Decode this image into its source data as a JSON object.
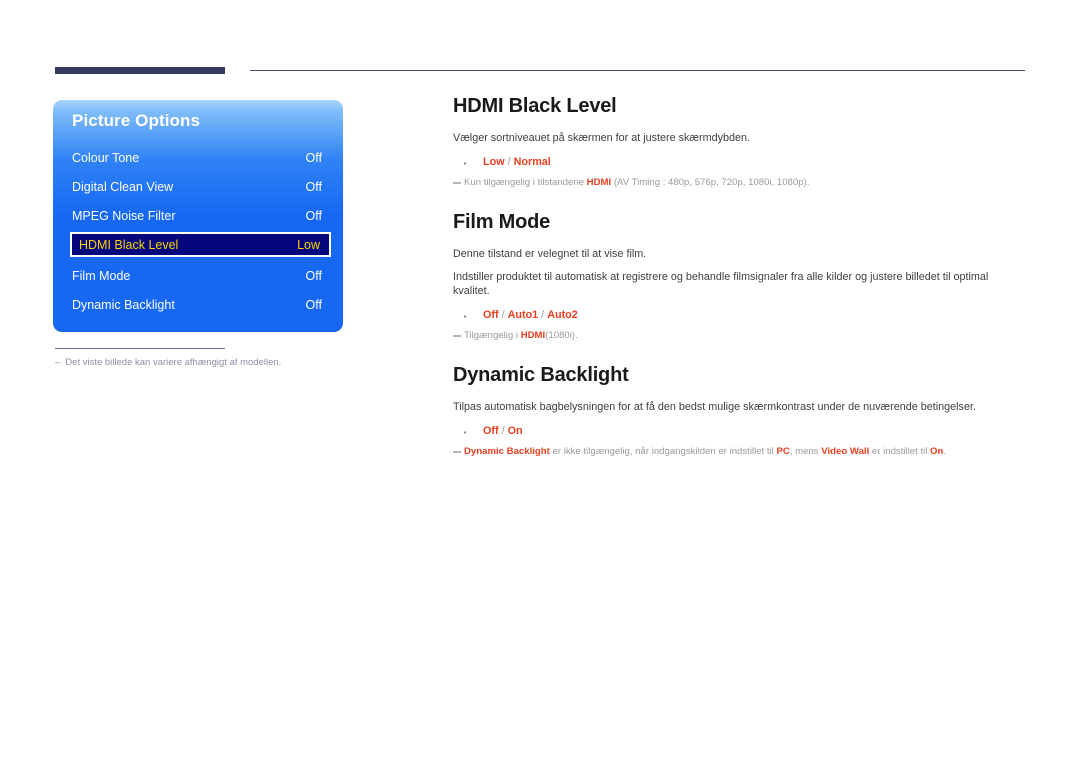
{
  "page": {
    "background": "#ffffff",
    "accent_color": "#E8401F",
    "rule_color": "#363B5E"
  },
  "osd": {
    "title": "Picture Options",
    "panel_top_color": "#a8d4fb",
    "panel_bottom_color": "#1668f2",
    "selected_bg": "#05057d",
    "selected_text_color": "#ffd400",
    "rows": [
      {
        "label": "Colour Tone",
        "value": "Off",
        "selected": false
      },
      {
        "label": "Digital Clean View",
        "value": "Off",
        "selected": false
      },
      {
        "label": "MPEG Noise Filter",
        "value": "Off",
        "selected": false
      },
      {
        "label": "HDMI Black Level",
        "value": "Low",
        "selected": true
      },
      {
        "label": "Film Mode",
        "value": "Off",
        "selected": false
      },
      {
        "label": "Dynamic Backlight",
        "value": "Off",
        "selected": false
      }
    ]
  },
  "footnote": {
    "dash": "–",
    "text": "Det viste billede kan variere afhængigt af modellen."
  },
  "sections": {
    "hdmi_black_level": {
      "heading": "HDMI Black Level",
      "paragraph": "Vælger sortniveauet på skærmen for at justere skærmdybden.",
      "option_main": "Low",
      "option_sep": " / ",
      "option_rest": "Normal",
      "note_pre": "Kun tilgængelig i tilstandene ",
      "note_hl": "HDMI",
      "note_post": " (AV Timing : 480p, 576p, 720p, 1080i, 1080p)."
    },
    "film_mode": {
      "heading": "Film Mode",
      "paragraph1": "Denne tilstand er velegnet til at vise film.",
      "paragraph2": "Indstiller produktet til automatisk at registrere og behandle filmsignaler fra alle kilder og justere billedet til optimal kvalitet.",
      "option_a": "Off",
      "option_sep1": " / ",
      "option_b": "Auto1",
      "option_sep2": " / ",
      "option_c": "Auto2",
      "note_pre": "Tilgængelig i ",
      "note_hl": "HDMI",
      "note_post": "(1080i)."
    },
    "dynamic_backlight": {
      "heading": "Dynamic Backlight",
      "paragraph": "Tilpas automatisk bagbelysningen for at få den bedst mulige skærmkontrast under de nuværende betingelser.",
      "option_a": "Off",
      "option_sep": " / ",
      "option_b": "On",
      "note_hl1": "Dynamic Backlight",
      "note_mid1": " er ikke tilgængelig, når indgangskilden er indstillet til ",
      "note_hl2": "PC",
      "note_mid2": ", mens ",
      "note_hl3": "Video Wall",
      "note_mid3": " er indstillet til ",
      "note_hl4": "On",
      "note_end": "."
    }
  }
}
